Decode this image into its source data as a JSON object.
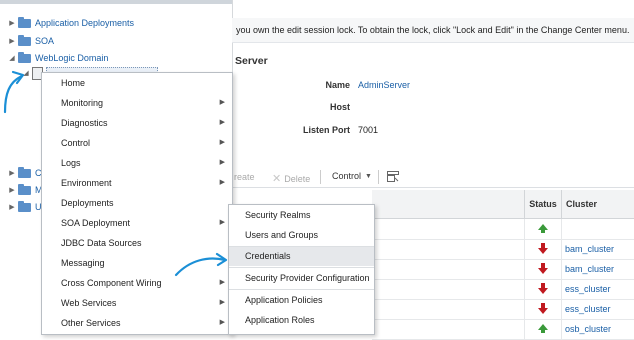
{
  "tree": {
    "items": [
      {
        "label": "Application Deployments",
        "expanded": false
      },
      {
        "label": "SOA",
        "expanded": false
      },
      {
        "label": "WebLogic Domain",
        "expanded": true
      }
    ],
    "lower_items": [
      {
        "label": "Co"
      },
      {
        "label": "Me"
      },
      {
        "label": "Us"
      }
    ]
  },
  "notice": {
    "text": "you own the edit session lock. To obtain the lock, click \"Lock and Edit\" in the Change Center menu."
  },
  "summary": {
    "title": "Server",
    "fields": [
      {
        "label": "Name",
        "value": "AdminServer",
        "is_link": true
      },
      {
        "label": "Host",
        "value": ""
      },
      {
        "label": "Listen Port",
        "value": "7001"
      }
    ]
  },
  "toolbar": {
    "create_label": "reate",
    "delete_label": "Delete",
    "control_label": "Control"
  },
  "table": {
    "headers": {
      "status": "Status",
      "cluster": "Cluster"
    },
    "rows": [
      {
        "status": "up",
        "cluster": ""
      },
      {
        "status": "down",
        "cluster": "bam_cluster"
      },
      {
        "status": "down",
        "cluster": "bam_cluster"
      },
      {
        "status": "down",
        "cluster": "ess_cluster"
      },
      {
        "status": "down",
        "cluster": "ess_cluster"
      },
      {
        "status": "up",
        "cluster": "osb_cluster"
      }
    ]
  },
  "menu_main": {
    "items": [
      {
        "label": "Home",
        "submenu": false
      },
      {
        "label": "Monitoring",
        "submenu": true
      },
      {
        "label": "Diagnostics",
        "submenu": true
      },
      {
        "label": "Control",
        "submenu": true
      },
      {
        "label": "Logs",
        "submenu": true
      },
      {
        "label": "Environment",
        "submenu": true
      },
      {
        "label": "Deployments",
        "submenu": false
      },
      {
        "label": "SOA Deployment",
        "submenu": true
      },
      {
        "label": "JDBC Data Sources",
        "submenu": false
      },
      {
        "label": "Messaging",
        "submenu": false
      },
      {
        "label": "Cross Component Wiring",
        "submenu": true
      },
      {
        "label": "Web Services",
        "submenu": true
      },
      {
        "label": "Other Services",
        "submenu": true
      }
    ]
  },
  "menu_sub": {
    "items": [
      {
        "label": "Security Realms",
        "highlighted": false
      },
      {
        "label": "Users and Groups",
        "highlighted": false
      },
      {
        "label": "Credentials",
        "highlighted": true
      },
      {
        "label": "Security Provider Configuration",
        "highlighted": false
      },
      {
        "label": "Application Policies",
        "highlighted": false
      },
      {
        "label": "Application Roles",
        "highlighted": false
      }
    ]
  },
  "colors": {
    "link": "#1a5fa6",
    "status_up": "#3a9a3a",
    "status_down": "#c0191f",
    "annotation": "#1b8fd6"
  }
}
